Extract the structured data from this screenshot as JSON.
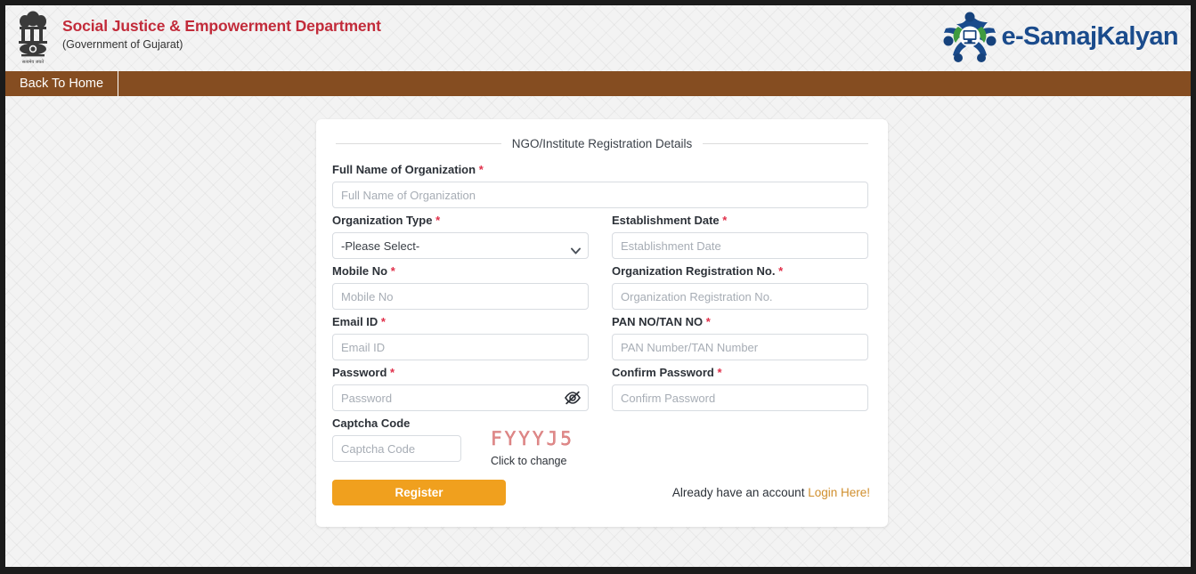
{
  "header": {
    "emblem_icon": "india-national-emblem",
    "department_title": "Social Justice & Empowerment Department",
    "government_subtitle": "(Government of Gujarat)",
    "brand_icon": "e-samajkalyan-people-computer-logo",
    "brand_name": "e-SamajKalyan"
  },
  "nav": {
    "items": [
      {
        "label": "Back To Home"
      }
    ]
  },
  "card": {
    "legend": "NGO/Institute Registration Details",
    "fields": {
      "org_name": {
        "label": "Full Name of Organization",
        "required": "*",
        "placeholder": "Full Name of Organization",
        "value": ""
      },
      "org_type": {
        "label": "Organization Type",
        "required": "*",
        "selected": "-Please Select-",
        "options": [
          "-Please Select-"
        ]
      },
      "establishment_date": {
        "label": "Establishment Date",
        "required": "*",
        "placeholder": "Establishment Date",
        "value": ""
      },
      "mobile_no": {
        "label": "Mobile No",
        "required": "*",
        "placeholder": "Mobile No",
        "value": ""
      },
      "org_reg_no": {
        "label": "Organization Registration No.",
        "required": "*",
        "placeholder": "Organization Registration No.",
        "value": ""
      },
      "email_id": {
        "label": "Email ID",
        "required": "*",
        "placeholder": "Email ID",
        "value": ""
      },
      "pan_tan": {
        "label": "PAN NO/TAN NO",
        "required": "*",
        "placeholder": "PAN Number/TAN Number",
        "value": ""
      },
      "password": {
        "label": "Password",
        "required": "*",
        "placeholder": "Password",
        "value": "",
        "toggle_icon": "eye-slash-icon"
      },
      "confirm_password": {
        "label": "Confirm Password",
        "required": "*",
        "placeholder": "Confirm Password",
        "value": ""
      },
      "captcha": {
        "label": "Captcha Code",
        "placeholder": "Captcha Code",
        "value": "",
        "code": "FYYYJ5",
        "refresh_hint": "Click to change"
      }
    },
    "register_button": "Register",
    "account_prompt": "Already have an account ",
    "login_link": "Login Here!"
  },
  "colors": {
    "title_red": "#c22b3a",
    "nav_brown": "#854d21",
    "brand_blue": "#1a4b8c",
    "button_orange": "#f0a01e",
    "link_orange": "#d08f2e",
    "required_red": "#e0304a",
    "captcha_red": "#e08a8a"
  }
}
